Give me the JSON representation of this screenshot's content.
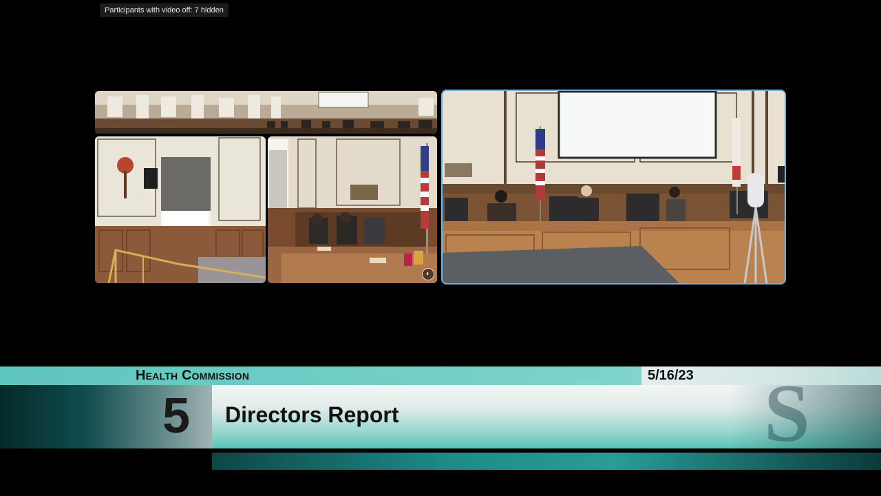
{
  "zoom": {
    "hidden_participants": "Participants with video off: 7 hidden"
  },
  "tiles": [
    {
      "name": "wide-room-view",
      "description_icon": "camera-feed"
    },
    {
      "name": "left-corner-view",
      "description_icon": "camera-feed"
    },
    {
      "name": "dais-side-view",
      "description_icon": "camera-feed"
    },
    {
      "name": "dais-front-view",
      "description_icon": "camera-feed",
      "active_speaker": true
    }
  ],
  "lower_third": {
    "commission": "Health Commission",
    "date": "5/16/23",
    "item_number": "5",
    "item_title": "Directors Report",
    "logo_glyph": "S",
    "colors": {
      "teal": "#5ec6bd",
      "dark_teal": "#0f4c4d",
      "active_border": "#6fb4e0"
    }
  }
}
